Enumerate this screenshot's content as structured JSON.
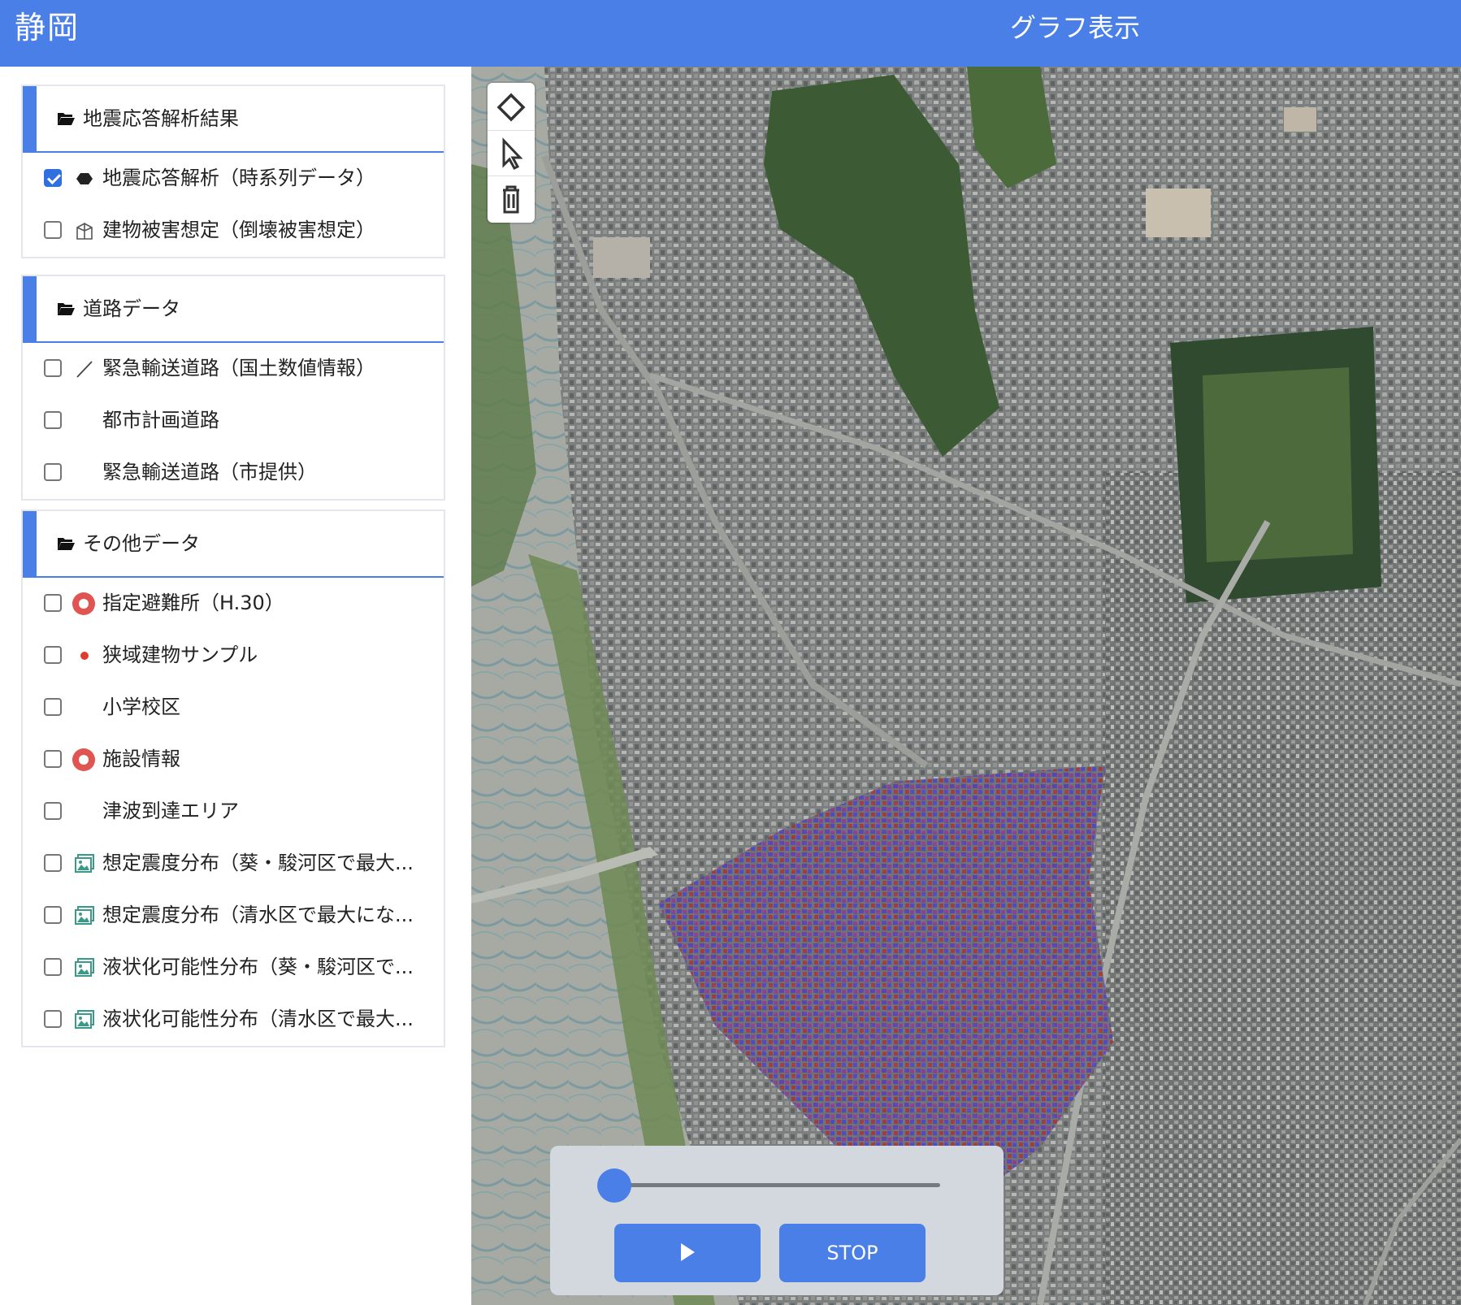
{
  "header": {
    "title": "静岡",
    "graph_link": "グラフ表示"
  },
  "sidebar": {
    "groups": [
      {
        "title": "地震応答解析結果",
        "layers": [
          {
            "label": "地震応答解析（時系列データ）",
            "checked": true,
            "icon": "hexagon-icon"
          },
          {
            "label": "建物被害想定（倒壊被害想定）",
            "checked": false,
            "icon": "building-icon"
          }
        ]
      },
      {
        "title": "道路データ",
        "layers": [
          {
            "label": "緊急輸送道路（国土数値情報）",
            "checked": false,
            "icon": "line-icon"
          },
          {
            "label": "都市計画道路",
            "checked": false,
            "icon": ""
          },
          {
            "label": "緊急輸送道路（市提供）",
            "checked": false,
            "icon": ""
          }
        ]
      },
      {
        "title": "その他データ",
        "layers": [
          {
            "label": "指定避難所（H.30）",
            "checked": false,
            "icon": "map-pin-icon"
          },
          {
            "label": "狭域建物サンプル",
            "checked": false,
            "icon": "red-dot-icon"
          },
          {
            "label": "小学校区",
            "checked": false,
            "icon": ""
          },
          {
            "label": "施設情報",
            "checked": false,
            "icon": "map-pin-icon"
          },
          {
            "label": "津波到達エリア",
            "checked": false,
            "icon": ""
          },
          {
            "label": "想定震度分布（葵・駿河区で最大...",
            "checked": false,
            "icon": "image-icon"
          },
          {
            "label": "想定震度分布（清水区で最大にな...",
            "checked": false,
            "icon": "image-icon"
          },
          {
            "label": "液状化可能性分布（葵・駿河区で...",
            "checked": false,
            "icon": "image-icon"
          },
          {
            "label": "液状化可能性分布（清水区で最大...",
            "checked": false,
            "icon": "image-icon"
          }
        ]
      }
    ]
  },
  "map": {
    "tools": [
      "polygon-tool-icon",
      "select-tool-icon",
      "trash-icon"
    ],
    "player": {
      "play_icon": "play-icon",
      "stop_label": "STOP",
      "slider_value": 0
    }
  },
  "colors": {
    "accent": "#4a7fe8",
    "checkbox_checked": "#2f6fe0",
    "pin_red": "#e0554f",
    "dot_red": "#e03b2f",
    "image_icon_green": "#3a9a8a"
  }
}
